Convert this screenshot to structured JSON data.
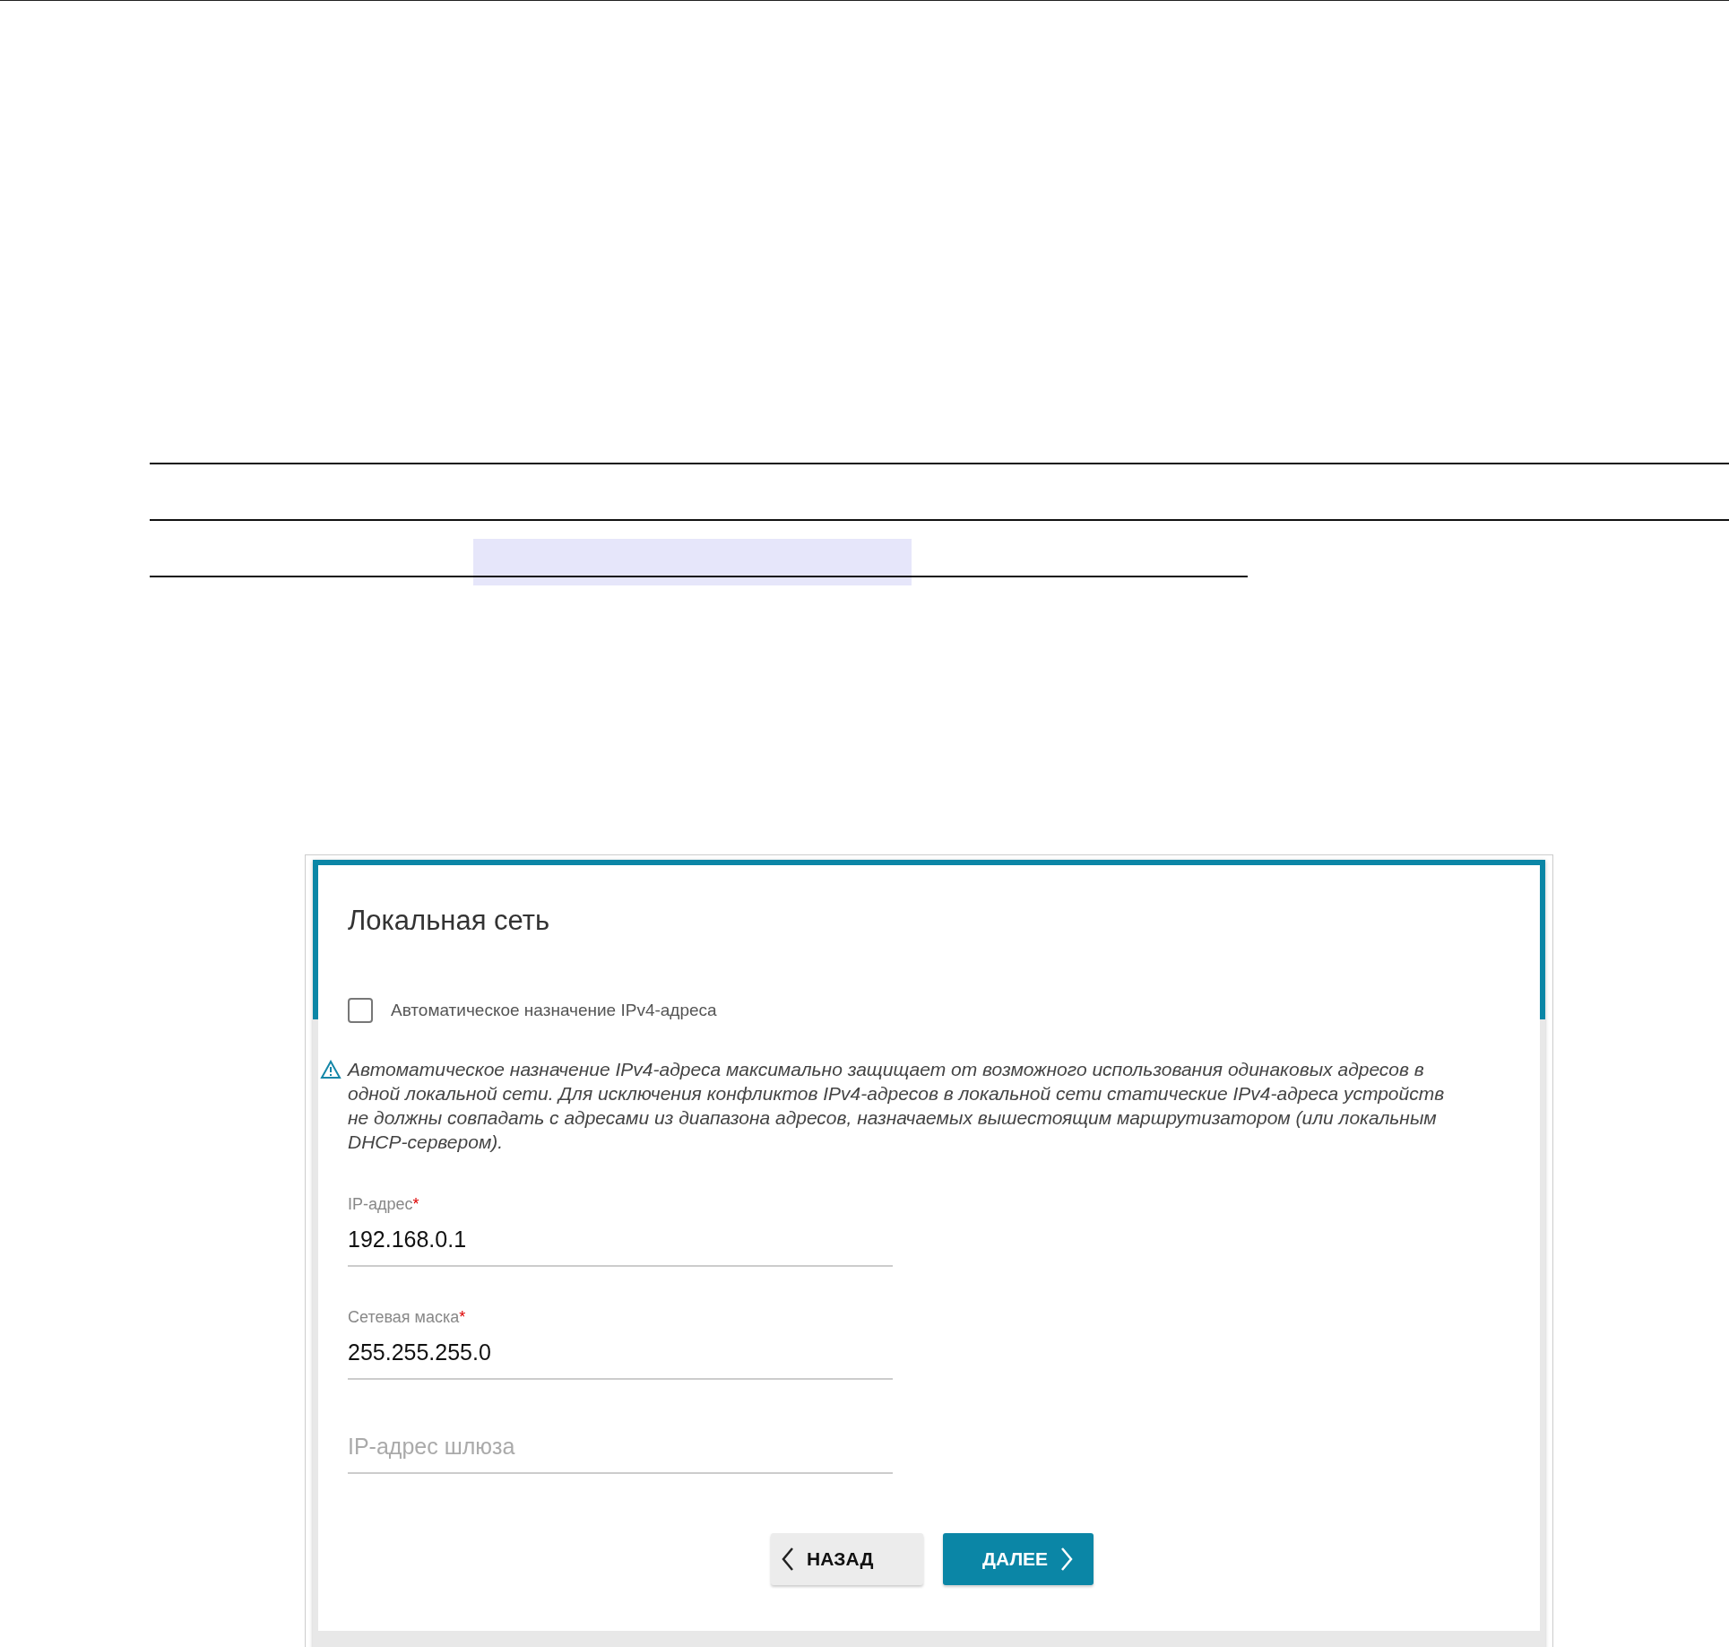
{
  "panel": {
    "title": "Локальная сеть",
    "checkbox": {
      "label": "Автоматическое назначение IPv4-адреса",
      "checked": false
    },
    "warning": "Автоматическое назначение IPv4-адреса максимально защищает от возможного использования одинаковых адресов в одной локальной сети. Для исключения конфликтов IPv4-адресов в локальной сети статические IPv4-адреса устройств не должны совпадать с адресами из диапазона адресов, назначаемых вышестоящим маршрутизатором (или локальным DHCP-сервером).",
    "fields": [
      {
        "label": "IP-адрес",
        "mark": "*",
        "value": "192.168.0.1"
      },
      {
        "label": "Сетевая маска",
        "mark": "*",
        "value": "255.255.255.0"
      },
      {
        "placeholder": "IP-адрес шлюза"
      }
    ],
    "buttons": [
      {
        "label": "НАЗАД",
        "kind": "back"
      },
      {
        "label": "ДАЛЕЕ",
        "kind": "next"
      }
    ]
  }
}
